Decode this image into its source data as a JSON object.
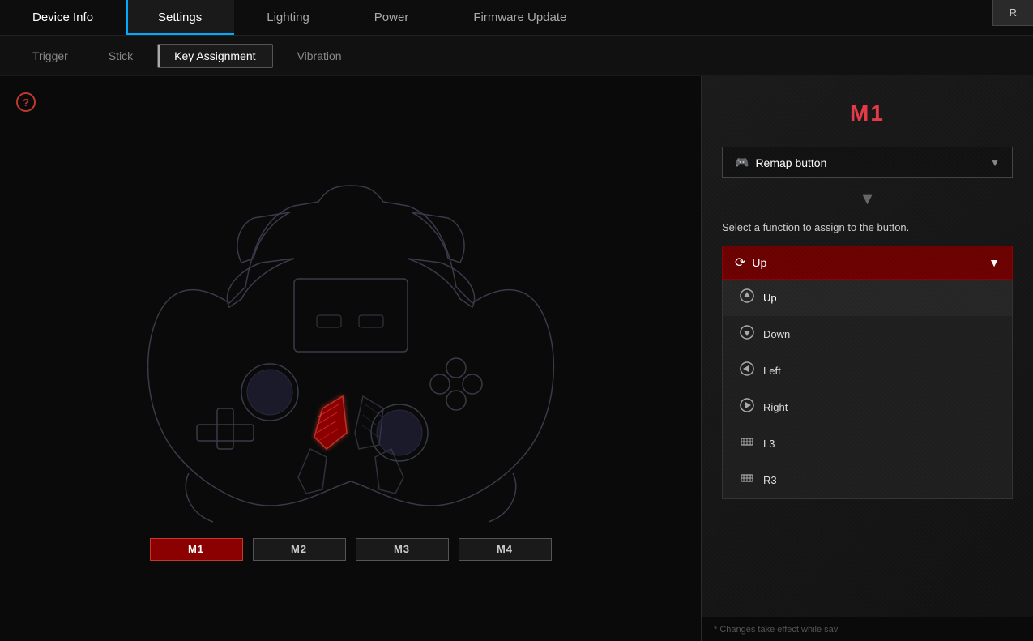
{
  "nav": {
    "items": [
      {
        "id": "device-info",
        "label": "Device Info",
        "active": false
      },
      {
        "id": "settings",
        "label": "Settings",
        "active": true
      },
      {
        "id": "lighting",
        "label": "Lighting",
        "active": false
      },
      {
        "id": "power",
        "label": "Power",
        "active": false
      },
      {
        "id": "firmware-update",
        "label": "Firmware Update",
        "active": false
      }
    ]
  },
  "sub_nav": {
    "items": [
      {
        "id": "trigger",
        "label": "Trigger",
        "active": false
      },
      {
        "id": "stick",
        "label": "Stick",
        "active": false
      },
      {
        "id": "key-assignment",
        "label": "Key Assignment",
        "active": true
      },
      {
        "id": "vibration",
        "label": "Vibration",
        "active": false
      }
    ]
  },
  "top_right_button": {
    "label": "R"
  },
  "help_icon": {
    "label": "?"
  },
  "m_buttons": [
    {
      "id": "m1",
      "label": "M1",
      "active": true
    },
    {
      "id": "m2",
      "label": "M2",
      "active": false
    },
    {
      "id": "m3",
      "label": "M3",
      "active": false
    },
    {
      "id": "m4",
      "label": "M4",
      "active": false
    }
  ],
  "right_panel": {
    "title": "M1",
    "remap_dropdown": {
      "icon": "🎮",
      "label": "Remap button",
      "chevron": "▼"
    },
    "arrow_indicator": "▼",
    "select_text": "Select a function to assign to the button.",
    "function_dropdown": {
      "selected_label": "Up",
      "chevron": "▼",
      "options": [
        {
          "id": "up",
          "icon": "↑",
          "label": "Up",
          "selected": true
        },
        {
          "id": "down",
          "icon": "↓",
          "label": "Down",
          "selected": false
        },
        {
          "id": "left",
          "icon": "←",
          "label": "Left",
          "selected": false
        },
        {
          "id": "right",
          "icon": "→",
          "label": "Right",
          "selected": false
        },
        {
          "id": "l3",
          "icon": "⊕",
          "label": "L3",
          "selected": false
        },
        {
          "id": "r3",
          "icon": "⊕",
          "label": "R3",
          "selected": false
        }
      ]
    }
  },
  "status_bar": {
    "text": "* Changes take effect while sav"
  },
  "colors": {
    "accent_red": "#e63946",
    "active_button_bg": "#8b0000",
    "nav_active_accent": "#00aaff"
  }
}
